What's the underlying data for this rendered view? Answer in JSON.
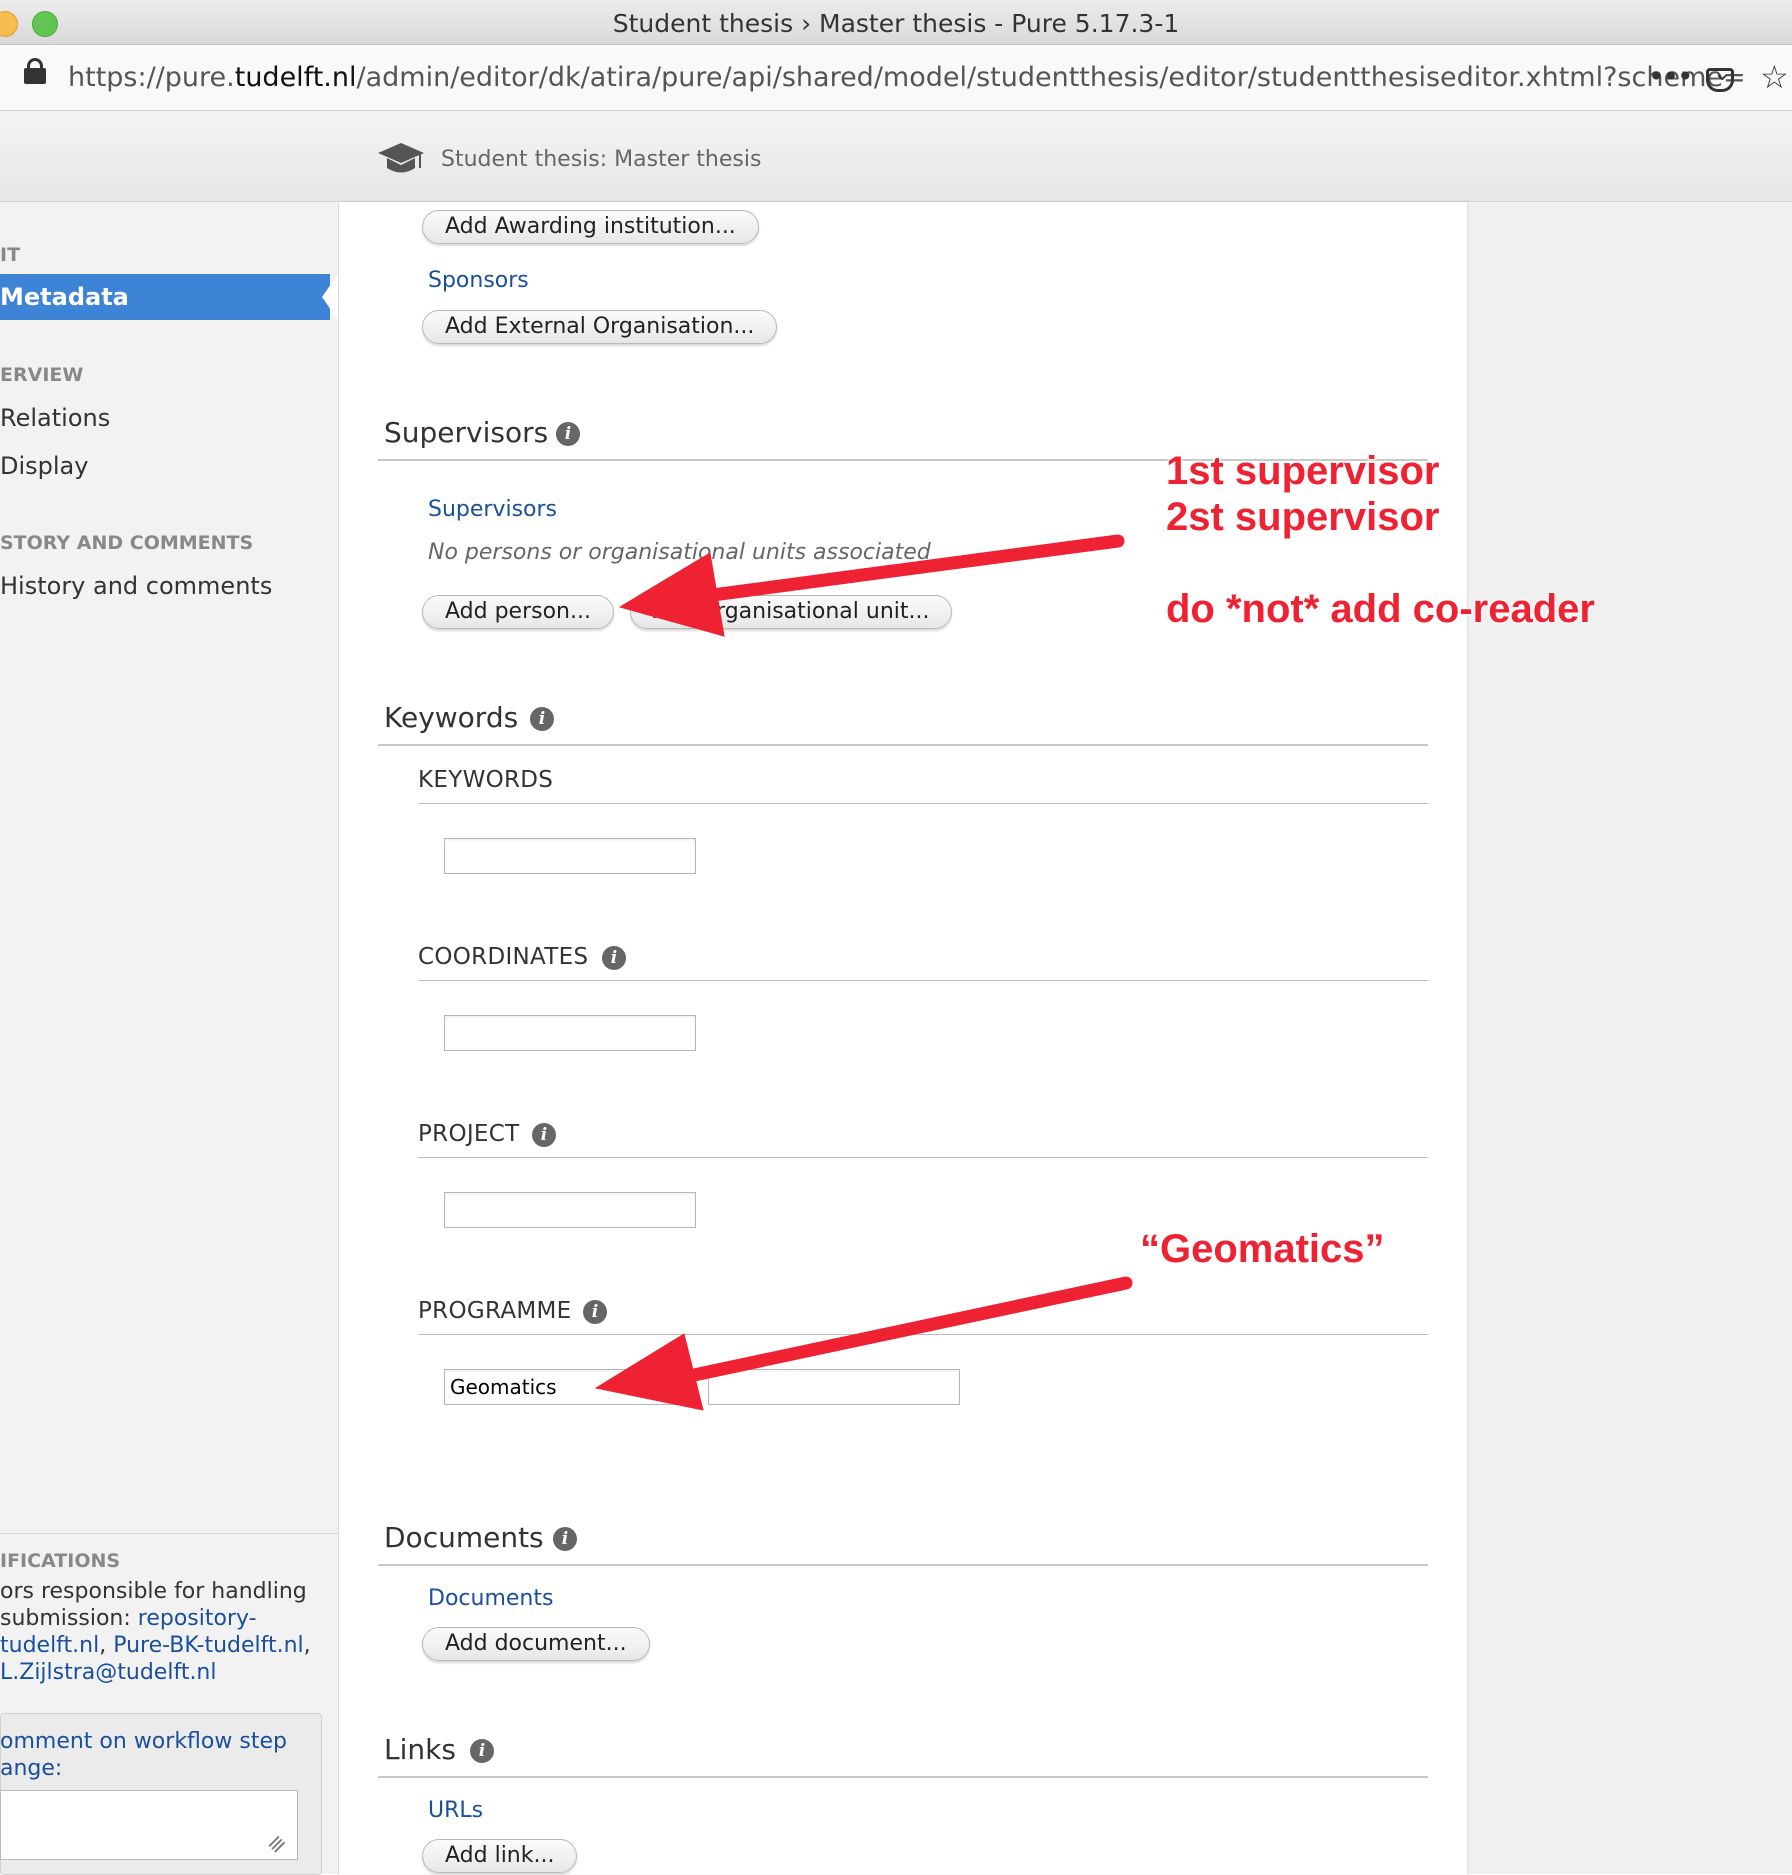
{
  "window": {
    "title": "Student thesis › Master thesis - Pure 5.17.3-1"
  },
  "browser": {
    "url_prefix": "https://pure.",
    "url_domain": "tudelft.nl",
    "url_path": "/admin/editor/dk/atira/pure/api/shared/model/studentthesis/editor/studentthesiseditor.xhtml?scheme=",
    "more_label": "•••"
  },
  "header": {
    "title": "Student thesis: Master thesis"
  },
  "sidebar": {
    "section_edit": "IT",
    "metadata_label": "Metadata",
    "section_overview": "ERVIEW",
    "relations_label": "Relations",
    "display_label": "Display",
    "section_history": "STORY AND COMMENTS",
    "history_label": "History and comments",
    "section_notifications": "IFICATIONS",
    "notif_text": "ors responsible for handling submission:",
    "notif_link_1": "repository-tudelft.nl",
    "notif_link_2": "Pure-BK-tudelft.nl",
    "notif_link_3": "L.Zijlstra@tudelft.nl",
    "comment_label": "omment on workflow step ange:",
    "comment_value": ""
  },
  "form": {
    "add_awarding_institution": "Add Awarding institution...",
    "sponsors_label": "Sponsors",
    "add_external_org": "Add External Organisation...",
    "supervisors_title": "Supervisors",
    "supervisors_sublabel": "Supervisors",
    "no_persons_text": "No persons or organisational units associated",
    "add_person": "Add person...",
    "add_org_unit": "Add organisational unit...",
    "keywords_title": "Keywords",
    "keywords_label": "KEYWORDS",
    "keywords_value": "",
    "coordinates_label": "COORDINATES",
    "coordinates_value": "",
    "project_label": "PROJECT",
    "project_value": "",
    "programme_label": "PROGRAMME",
    "programme_value": "Geomatics",
    "programme_value_2": "",
    "documents_title": "Documents",
    "documents_sublabel": "Documents",
    "add_document": "Add document...",
    "links_title": "Links",
    "urls_sublabel": "URLs",
    "add_link": "Add link..."
  },
  "annotations": {
    "supervisor_1": "1st supervisor",
    "supervisor_2": "2st supervisor",
    "no_coreader": "do *not* add co-reader",
    "geomatics": "“Geomatics”",
    "color": "#ee2233"
  },
  "icons": [
    "lock-icon",
    "pocket-icon",
    "star-icon",
    "graduation-cap-icon",
    "info-icon",
    "resize-grip-icon"
  ]
}
